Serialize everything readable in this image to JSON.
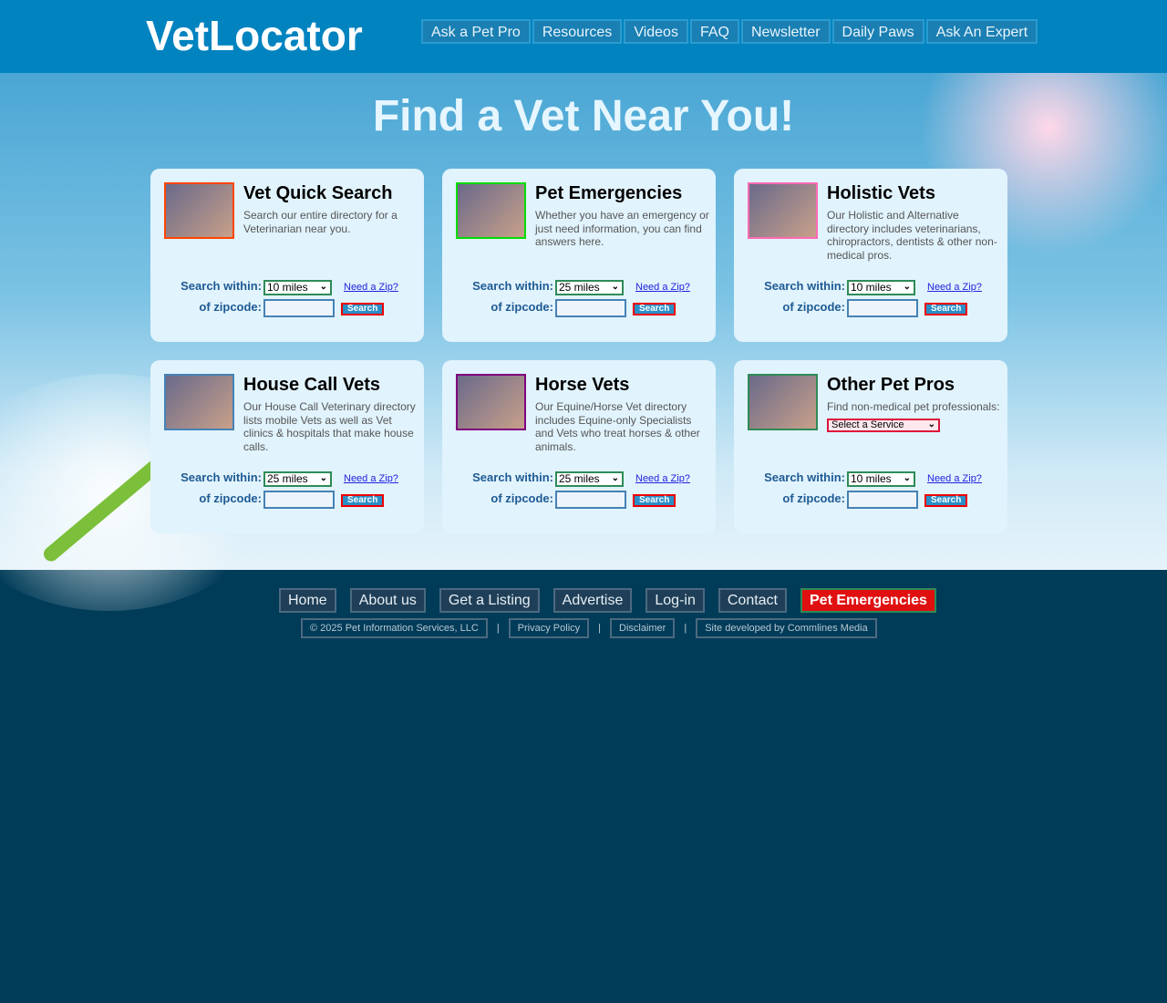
{
  "header": {
    "logo": "VetLocator",
    "nav": [
      "Ask a Pet Pro",
      "Resources",
      "Videos",
      "FAQ",
      "Newsletter",
      "Daily Paws",
      "Ask An Expert"
    ]
  },
  "hero": {
    "title": "Find a Vet Near You!"
  },
  "labels": {
    "within": "Search within:",
    "zip": "of zipcode:",
    "need_zip": "Need a Zip?",
    "search": "Search"
  },
  "cards": [
    {
      "title": "Vet Quick Search",
      "desc": "Search our entire directory for a Veterinarian near you.",
      "radius": "10 miles",
      "border": "#ff4500"
    },
    {
      "title": "Pet Emergencies",
      "desc": "Whether you have an emergency or just need information, you can find answers here.",
      "radius": "25 miles",
      "border": "#00dd00"
    },
    {
      "title": "Holistic Vets",
      "desc": "Our Holistic and Alternative directory includes veterinarians, chiropractors, dentists & other non-medical pros.",
      "radius": "10 miles",
      "border": "#ff69b4"
    },
    {
      "title": "House Call Vets",
      "desc": "Our House Call Veterinary directory lists mobile Vets as well as Vet clinics & hospitals that make house calls.",
      "radius": "25 miles",
      "border": "#4682b4"
    },
    {
      "title": "Horse Vets",
      "desc": "Our Equine/Horse Vet directory includes Equine-only Specialists and Vets who treat horses & other animals.",
      "radius": "25 miles",
      "border": "#800080"
    },
    {
      "title": "Other Pet Pros",
      "desc": "Find non-medical pet professionals:",
      "radius": "10 miles",
      "border": "#2e8b57",
      "service": "Select a Service"
    }
  ],
  "footer": {
    "nav": [
      "Home",
      "About us",
      "Get a Listing",
      "Advertise",
      "Log-in",
      "Contact",
      "Pet Emergencies"
    ],
    "copyright": "© 2025 Pet Information Services, LLC",
    "privacy": "Privacy Policy",
    "disclaimer": "Disclaimer",
    "credit": "Site developed by Commlines Media",
    "sep": "|"
  }
}
